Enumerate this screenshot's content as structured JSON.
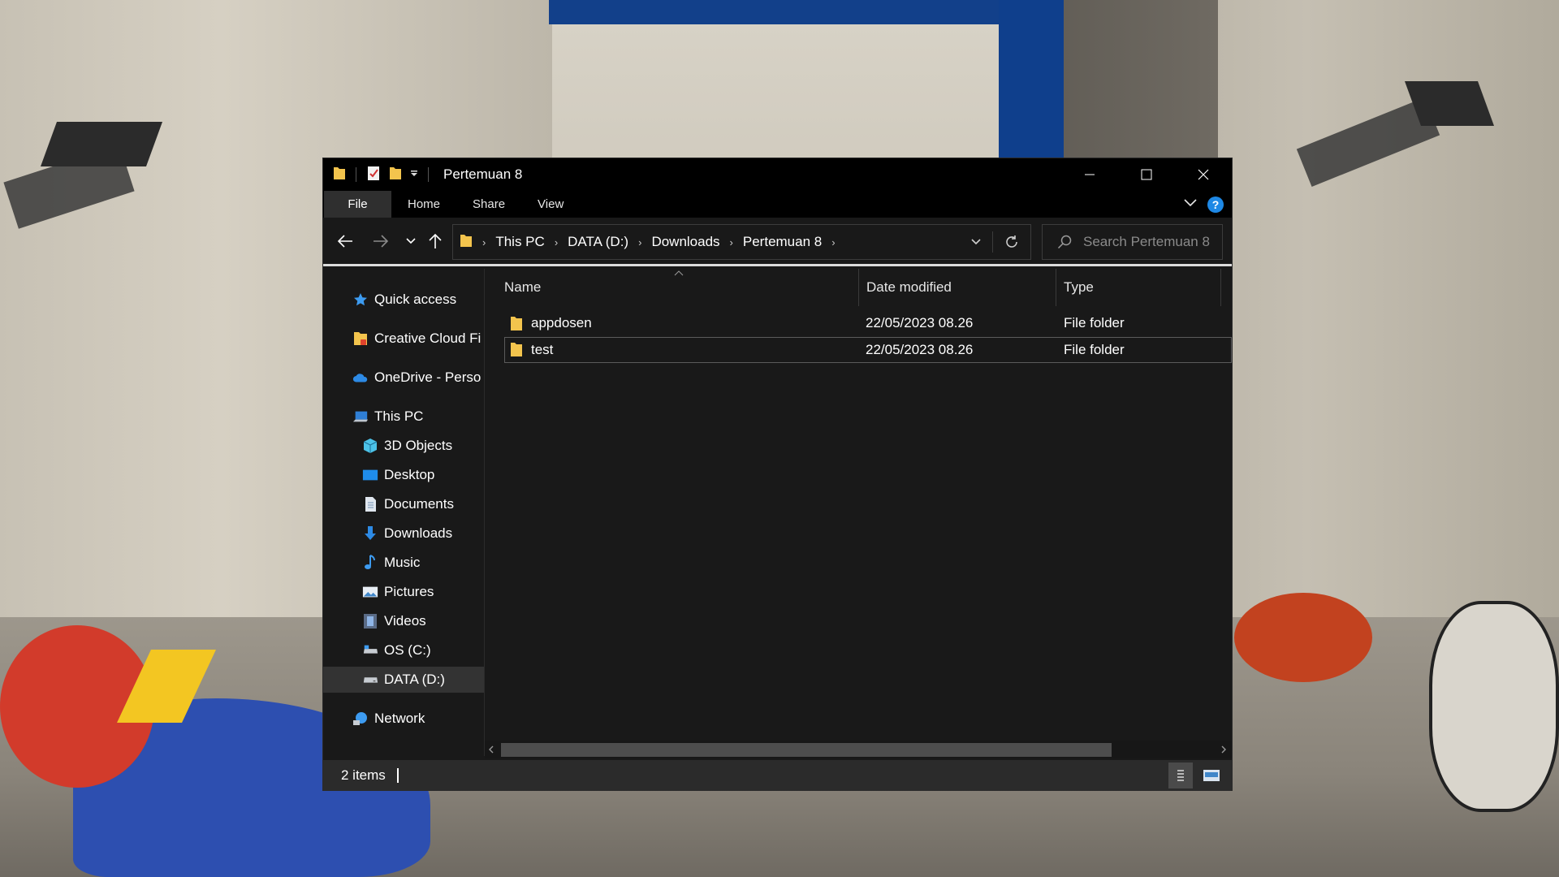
{
  "window": {
    "title": "Pertemuan 8",
    "controls": {
      "minimize": "minimize",
      "maximize": "maximize",
      "close": "close"
    }
  },
  "ribbon": {
    "tabs": [
      "File",
      "Home",
      "Share",
      "View"
    ],
    "help_label": "?"
  },
  "navigation": {
    "breadcrumb": [
      "This PC",
      "DATA (D:)",
      "Downloads",
      "Pertemuan 8"
    ],
    "search_placeholder": "Search Pertemuan 8"
  },
  "sidebar": {
    "items": [
      {
        "label": "Quick access",
        "icon": "star-icon",
        "level": 0
      },
      {
        "label": "Creative Cloud Fi",
        "icon": "creative-cloud-folder-icon",
        "level": 0
      },
      {
        "label": "OneDrive - Perso",
        "icon": "onedrive-cloud-icon",
        "level": 0
      },
      {
        "label": "This PC",
        "icon": "computer-icon",
        "level": 0
      },
      {
        "label": "3D Objects",
        "icon": "cube-icon",
        "level": 1
      },
      {
        "label": "Desktop",
        "icon": "desktop-icon",
        "level": 1
      },
      {
        "label": "Documents",
        "icon": "document-icon",
        "level": 1
      },
      {
        "label": "Downloads",
        "icon": "download-arrow-icon",
        "level": 1
      },
      {
        "label": "Music",
        "icon": "music-note-icon",
        "level": 1
      },
      {
        "label": "Pictures",
        "icon": "picture-icon",
        "level": 1
      },
      {
        "label": "Videos",
        "icon": "film-icon",
        "level": 1
      },
      {
        "label": "OS (C:)",
        "icon": "os-drive-icon",
        "level": 1
      },
      {
        "label": "DATA (D:)",
        "icon": "drive-icon",
        "level": 1,
        "selected": true
      },
      {
        "label": "Network",
        "icon": "network-icon",
        "level": 0
      }
    ]
  },
  "files": {
    "columns": [
      "Name",
      "Date modified",
      "Type"
    ],
    "rows": [
      {
        "name": "appdosen",
        "date": "22/05/2023 08.26",
        "type": "File folder"
      },
      {
        "name": "test",
        "date": "22/05/2023 08.26",
        "type": "File folder",
        "selected": true
      }
    ]
  },
  "status": {
    "item_count": "2 items"
  },
  "colors": {
    "window_bg": "#191919",
    "titlebar_bg": "#000000",
    "folder_yellow": "#f3c44d",
    "accent_blue": "#1e88e5",
    "selection": "#333333"
  }
}
